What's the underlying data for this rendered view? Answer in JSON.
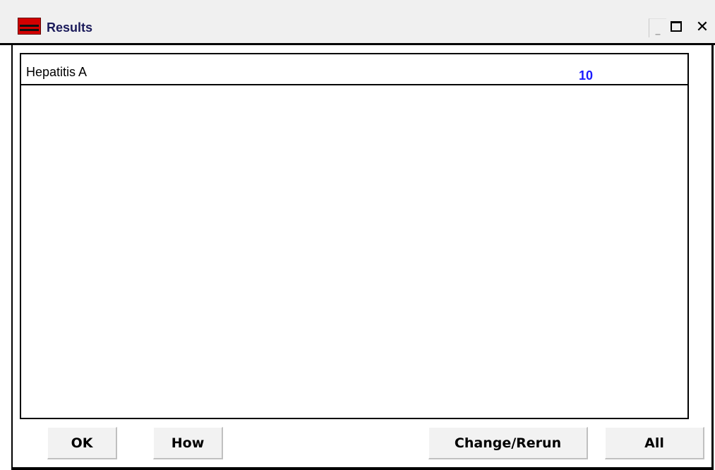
{
  "window": {
    "title": "Results",
    "app_icon": "app-logo-icon",
    "controls": {
      "minimize_icon": "minimize-icon",
      "maximize_icon": "maximize-icon",
      "close_icon": "close-icon",
      "minimize_glyph": "_",
      "close_glyph": "✕"
    }
  },
  "results": {
    "items": [
      {
        "name": "Hepatitis A",
        "value": "10"
      }
    ]
  },
  "buttons": {
    "ok": "OK",
    "how": "How",
    "change_rerun": "Change/Rerun",
    "all": "All"
  },
  "colors": {
    "value_text": "#1a1aff",
    "title_text": "#1a1a5a",
    "app_icon": "#d40000"
  }
}
